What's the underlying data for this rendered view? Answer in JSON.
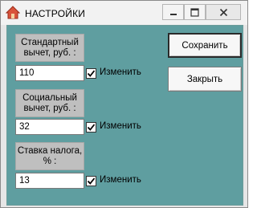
{
  "window": {
    "title": "НАСТРОЙКИ"
  },
  "fields": [
    {
      "label": "Стандартный вычет, руб. :",
      "value": "110",
      "checkbox_label": "Изменить",
      "checked": true
    },
    {
      "label": "Социальный вычет, руб. :",
      "value": "32",
      "checkbox_label": "Изменить",
      "checked": true
    },
    {
      "label": "Ставка налога, % :",
      "value": "13",
      "checkbox_label": "Изменить",
      "checked": true
    }
  ],
  "buttons": {
    "save_label": "Сохранить",
    "close_label": "Закрыть"
  },
  "colors": {
    "client_background": "#5f9ea0",
    "label_background": "#bfbfbf",
    "app_icon": "#d9533a"
  },
  "icons": {
    "app": "house-icon",
    "minimize": "minimize-icon",
    "maximize": "maximize-icon",
    "close": "close-icon",
    "check": "checkmark-icon"
  }
}
